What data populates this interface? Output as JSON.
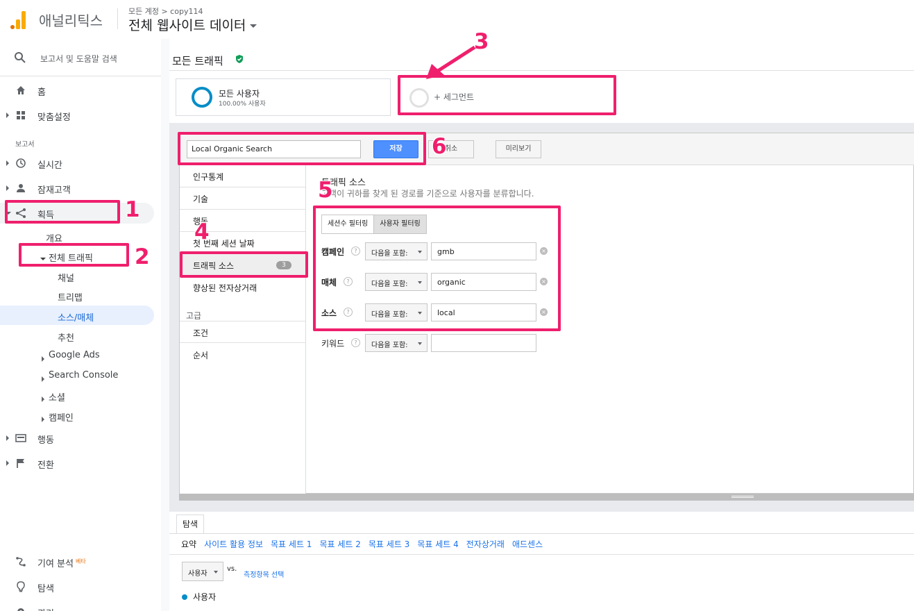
{
  "header": {
    "brand": "애널리틱스",
    "breadcrumb": "모든 계정 > copy114",
    "view_name": "전체 웹사이트 데이터"
  },
  "sidebar": {
    "search_placeholder": "보고서 및 도움말 검색",
    "home": "홈",
    "customization": "맞춤설정",
    "reports_label": "보고서",
    "realtime": "실시간",
    "audience": "잠재고객",
    "acquisition": "획득",
    "acq_items": {
      "overview": "개요",
      "all_traffic": "전체 트래픽",
      "channels": "채널",
      "treemaps": "트리맵",
      "source_medium": "소스/매체",
      "referrals": "추천",
      "google_ads": "Google Ads",
      "search_console": "Search Console",
      "social": "소셜",
      "campaigns": "캠페인"
    },
    "behavior": "행동",
    "conversions": "전환",
    "attribution": "기여 분석",
    "attribution_badge": "베타",
    "discover": "탐색",
    "admin": "관리"
  },
  "main": {
    "page_title": "모든 트래픽",
    "segments": {
      "all_users_label": "모든 사용자",
      "all_users_pct": "100.00% 사용자",
      "add_segment": "+ 세그먼트"
    },
    "segment_editor": {
      "name_value": "Local Organic Search",
      "save": "저장",
      "cancel": "취소",
      "preview": "미리보기",
      "categories": [
        "인구통계",
        "기술",
        "행동",
        "첫 번째 세션 날짜",
        "트래픽 소스",
        "향상된 전자상거래"
      ],
      "traffic_source_badge": "3",
      "advanced_label": "고급",
      "advanced_items": [
        "조건",
        "순서"
      ],
      "panel_title": "트래픽 소스",
      "panel_desc": "고객이 귀하를 찾게 된 경로를 기준으로 사용자를 분류합니다.",
      "toggle_session": "세션수 필터링",
      "toggle_user": "사용자 필터링",
      "filters": [
        {
          "label": "캠페인",
          "op": "다음을 포함:",
          "value": "gmb"
        },
        {
          "label": "매체",
          "op": "다음을 포함:",
          "value": "organic"
        },
        {
          "label": "소스",
          "op": "다음을 포함:",
          "value": "local"
        },
        {
          "label": "키워드",
          "op": "다음을 포함:",
          "value": ""
        }
      ]
    },
    "explorer": {
      "tab": "탐색",
      "links": [
        "요약",
        "사이트 활용 정보",
        "목표 세트 1",
        "목표 세트 2",
        "목표 세트 3",
        "목표 세트 4",
        "전자상거래",
        "애드센스"
      ],
      "metric": "사용자",
      "vs": "vs.",
      "pick_metric": "측정항목 선택",
      "legend": "사용자"
    }
  },
  "annotations": [
    "1",
    "2",
    "3",
    "4",
    "5",
    "6"
  ],
  "colors": {
    "annotation": "#ef1f6d",
    "accent_blue": "#4d90fe",
    "segment_ring": "#058dc7"
  }
}
